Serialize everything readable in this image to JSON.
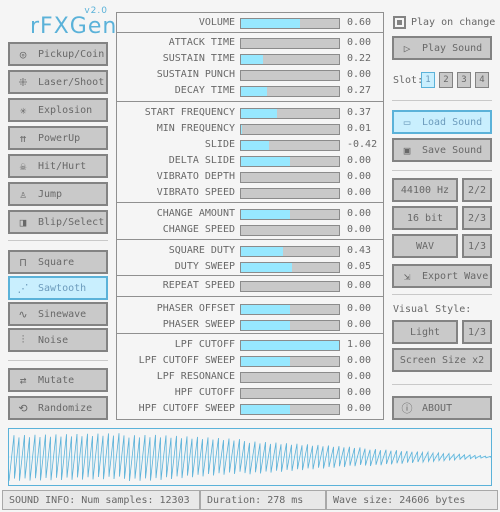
{
  "app": {
    "name": "rFXGen",
    "version": "v2.0"
  },
  "presets": [
    {
      "label": "Pickup/Coin",
      "icon": "coin-icon"
    },
    {
      "label": "Laser/Shoot",
      "icon": "laser-icon"
    },
    {
      "label": "Explosion",
      "icon": "explosion-icon"
    },
    {
      "label": "PowerUp",
      "icon": "powerup-icon"
    },
    {
      "label": "Hit/Hurt",
      "icon": "skull-icon"
    },
    {
      "label": "Jump",
      "icon": "jump-icon"
    },
    {
      "label": "Blip/Select",
      "icon": "blip-icon"
    }
  ],
  "waveforms": [
    {
      "label": "Square",
      "icon": "square-wave-icon",
      "selected": false
    },
    {
      "label": "Sawtooth",
      "icon": "sawtooth-wave-icon",
      "selected": true
    },
    {
      "label": "Sinewave",
      "icon": "sine-wave-icon",
      "selected": false
    },
    {
      "label": "Noise",
      "icon": "noise-icon",
      "selected": false
    }
  ],
  "actions": {
    "mutate": "Mutate",
    "randomize": "Randomize"
  },
  "params": [
    {
      "label": "VOLUME",
      "value": "0.60",
      "fill": 0.6
    },
    {
      "label": "ATTACK TIME",
      "value": "0.00",
      "fill": 0.0
    },
    {
      "label": "SUSTAIN TIME",
      "value": "0.22",
      "fill": 0.22
    },
    {
      "label": "SUSTAIN PUNCH",
      "value": "0.00",
      "fill": 0.0
    },
    {
      "label": "DECAY TIME",
      "value": "0.27",
      "fill": 0.27
    },
    {
      "label": "START FREQUENCY",
      "value": "0.37",
      "fill": 0.37
    },
    {
      "label": "MIN FREQUENCY",
      "value": "0.01",
      "fill": 0.01
    },
    {
      "label": "SLIDE",
      "value": "-0.42",
      "fill": 0.29
    },
    {
      "label": "DELTA SLIDE",
      "value": "0.00",
      "fill": 0.5
    },
    {
      "label": "VIBRATO DEPTH",
      "value": "0.00",
      "fill": 0.0
    },
    {
      "label": "VIBRATO SPEED",
      "value": "0.00",
      "fill": 0.0
    },
    {
      "label": "CHANGE AMOUNT",
      "value": "0.00",
      "fill": 0.5
    },
    {
      "label": "CHANGE SPEED",
      "value": "0.00",
      "fill": 0.0
    },
    {
      "label": "SQUARE DUTY",
      "value": "0.43",
      "fill": 0.43
    },
    {
      "label": "DUTY SWEEP",
      "value": "0.05",
      "fill": 0.52
    },
    {
      "label": "REPEAT SPEED",
      "value": "0.00",
      "fill": 0.0
    },
    {
      "label": "PHASER OFFSET",
      "value": "0.00",
      "fill": 0.5
    },
    {
      "label": "PHASER SWEEP",
      "value": "0.00",
      "fill": 0.5
    },
    {
      "label": "LPF CUTOFF",
      "value": "1.00",
      "fill": 1.0
    },
    {
      "label": "LPF CUTOFF SWEEP",
      "value": "0.00",
      "fill": 0.5
    },
    {
      "label": "LPF RESONANCE",
      "value": "0.00",
      "fill": 0.0
    },
    {
      "label": "HPF CUTOFF",
      "value": "0.00",
      "fill": 0.0
    },
    {
      "label": "HPF CUTOFF SWEEP",
      "value": "0.00",
      "fill": 0.5
    }
  ],
  "right": {
    "play_on_change": "Play on change",
    "play_on_change_checked": true,
    "play_sound": "Play Sound",
    "slot_label": "Slot:",
    "slots": [
      "1",
      "2",
      "3",
      "4"
    ],
    "selected_slot": "1",
    "load_sound": "Load Sound",
    "save_sound": "Save Sound",
    "sample_rate": "44100 Hz",
    "sample_rate_page": "2/2",
    "bit_depth": "16 bit",
    "bit_depth_page": "2/3",
    "format": "WAV",
    "format_page": "1/3",
    "export_wave": "Export Wave",
    "visual_style_label": "Visual Style:",
    "style": "Light",
    "style_page": "1/3",
    "screen_size": "Screen Size x2",
    "about": "ABOUT"
  },
  "status": {
    "info": "SOUND INFO: Num samples: 12303",
    "duration": "Duration: 278 ms",
    "wave_size": "Wave size: 24606 bytes"
  },
  "colors": {
    "accent": "#5bb2d9",
    "fill": "#97e8ff",
    "selected_bg": "#c9effe",
    "button_bg": "#c9c9c9",
    "border": "#838383"
  }
}
